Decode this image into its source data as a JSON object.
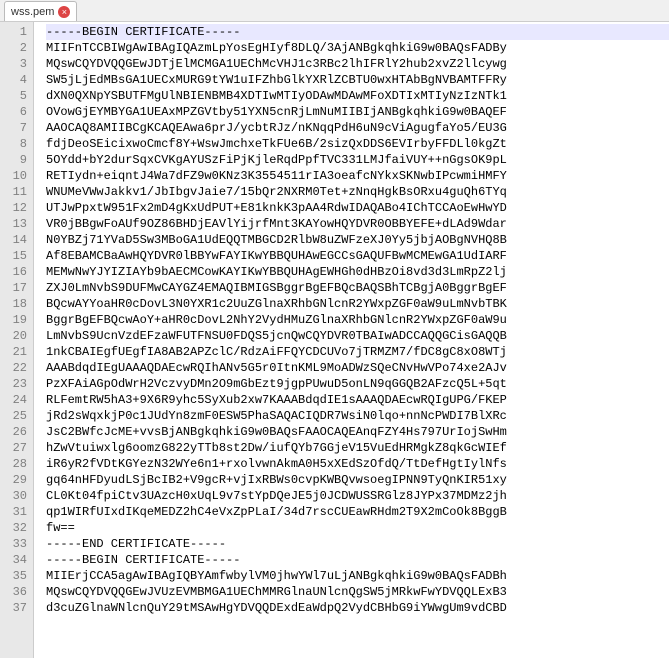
{
  "tab": {
    "filename": "wss.pem"
  },
  "lines": [
    "-----BEGIN CERTIFICATE-----",
    "MIIFnTCCBIWgAwIBAgIQAzmLpYosEgHIyf8DLQ/3AjANBgkqhkiG9w0BAQsFADBy",
    "MQswCQYDVQQGEwJDTjElMCMGA1UEChMcVHJ1c3RBc2lhIFRlY2hub2xvZ2llcywg",
    "SW5jLjEdMBsGA1UECxMURG9tYW1uIFZhbGlkYXRlZCBTU0wxHTAbBgNVBAMTFFRy",
    "dXN0QXNpYSBUTFMgUlNBIENBMB4XDTIwMTIyODAwMDAwMFoXDTIxMTIyNzIzNTk1",
    "OVowGjEYMBYGA1UEAxMPZGVtby51YXN5cnRjLmNuMIIBIjANBgkqhkiG9w0BAQEF",
    "AAOCAQ8AMIIBCgKCAQEAwa6prJ/ycbtRJz/nKNqqPdH6uN9cViAgugfaYo5/EU3G",
    "fdjDeoSEicixwoCmcf8Y+WswJmchxeTkFUe6B/2sizQxDDS6EVIrbyFFDLl0kgZt",
    "5OYdd+bY2durSqxCVKgAYUSzFiPjKjleRqdPpfTVC331LMJfaiVUY++nGgsOK9pL",
    "RETIydn+eiqntJ4Wa7dFZ9w0KNz3K3554511rIA3oeafcNYkxSKNwbIPcwmiHMFY",
    "WNUMeVWwJakkv1/JbIbgvJaie7/15bQr2NXRM0Tet+zNnqHgkBsORxu4guQh6TYq",
    "UTJwPpxtW951Fx2mD4gKxUdPUT+E81knkK3pAA4RdwIDAQABo4IChTCCAoEwHwYD",
    "VR0jBBgwFoAUf9OZ86BHDjEAVlYijrfMnt3KAYowHQYDVR0OBBYEFE+dLAd9Wdar",
    "N0YBZj71YVaD5Sw3MBoGA1UdEQQTMBGCD2RlbW8uZWFzeXJ0Yy5jbjAOBgNVHQ8B",
    "Af8EBAMCBaAwHQYDVR0lBBYwFAYIKwYBBQUHAwEGCCsGAQUFBwMCMEwGA1UdIARF",
    "MEMwNwYJYIZIAYb9bAECMCowKAYIKwYBBQUHAgEWHGh0dHBzOi8vd3d3LmRpZ2lj",
    "ZXJ0LmNvbS9DUFMwCAYGZ4EMAQIBMIGSBggrBgEFBQcBAQSBhTCBgjA0BggrBgEF",
    "BQcwAYYoaHR0cDovL3N0YXR1c2UuZGlnaXRhbGNlcnR2YWxpZGF0aW9uLmNvbTBK",
    "BggrBgEFBQcwAoY+aHR0cDovL2NhY2VydHMuZGlnaXRhbGNlcnR2YWxpZGF0aW9u",
    "LmNvbS9UcnVzdEFzaWFUTFNSU0FDQS5jcnQwCQYDVR0TBAIwADCCAQQGCisGAQQB",
    "1nkCBAIEgfUEgfIA8AB2APZclC/RdzAiFFQYCDCUVo7jTRMZM7/fDC8gC8xO8WTj",
    "AAABdqdIEgUAAAQDAEcwRQIhANv5G5r0ItnKML9MoADWzSQeCNvHwVPo74xe2AJv",
    "PzXFAiAGpOdWrH2VczvyDMn2O9mGbEzt9jgpPUwuD5onLN9qGGQB2AFzcQ5L+5qt",
    "RLFemtRW5hA3+9X6R9yhc5SyXub2xw7KAAABdqdIE1sAAAQDAEcwRQIgUPG/FKEP",
    "jRd2sWqxkjP0c1JUdYn8zmF0ESW5PhaSAQACIQDR7WsiN0lqo+nnNcPWDI7BlXRc",
    "JsC2BWfcJcME+vvsBjANBgkqhkiG9w0BAQsFAAOCAQEAnqFZY4Hs797UrIojSwHm",
    "hZwVtuiwxlg6oomzG822yTTb8st2Dw/iufQYb7GGjeV15VuEdHRMgkZ8qkGcWIEf",
    "iR6yR2fVDtKGYezN32WYe6n1+rxolvwnAkmA0H5xXEdSzOfdQ/TtDefHgtIylNfs",
    "gq64nHFDyudLSjBcIB2+V9gcR+vjIxRBWs0cvpKWBQvwsoegIPNN9TyQnKIR51xy",
    "CL0Kt04fpiCtv3UAzcH0xUqL9v7stYpDQeJE5j0JCDWUSSRGlz8JYPx37MDMz2jh",
    "qp1WIRfUIxdIKqeMEDZ2hC4eVxZpPLaI/34d7rscCUEawRHdm2T9X2mCoOk8BggB",
    "fw==",
    "-----END CERTIFICATE-----",
    "-----BEGIN CERTIFICATE-----",
    "MIIErjCCA5agAwIBAgIQBYAmfwbylVM0jhwYWl7uLjANBgkqhkiG9w0BAQsFADBh",
    "MQswCQYDVQQGEwJVUzEVMBMGA1UEChMMRGlnaUNlcnQgSW5jMRkwFwYDVQQLExB3",
    "d3cuZGlnaWNlcnQuY29tMSAwHgYDVQQDExdEaWdpQ2VydCBHbG9iYWwgUm9vdCBD"
  ],
  "current_line_index": 0
}
